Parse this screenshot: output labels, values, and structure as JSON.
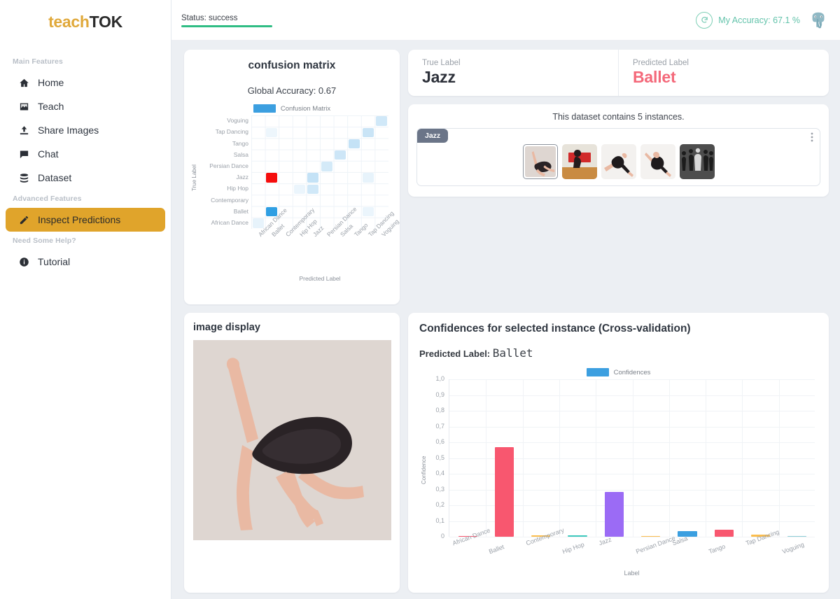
{
  "brand": {
    "part1": "teach",
    "part2": "TOK"
  },
  "sidebar": {
    "sections": [
      {
        "title": "Main Features"
      },
      {
        "title": "Advanced Features"
      },
      {
        "title": "Need Some Help?"
      }
    ],
    "items": [
      {
        "label": "Home",
        "icon": "home-icon"
      },
      {
        "label": "Teach",
        "icon": "image-icon"
      },
      {
        "label": "Share Images",
        "icon": "upload-icon"
      },
      {
        "label": "Chat",
        "icon": "chat-icon"
      },
      {
        "label": "Dataset",
        "icon": "database-icon"
      },
      {
        "label": "Inspect Predictions",
        "icon": "pencil-icon"
      },
      {
        "label": "Tutorial",
        "icon": "info-icon"
      }
    ]
  },
  "topbar": {
    "status_text": "Status: success",
    "accuracy_text": "My Accuracy: 67.1 %",
    "refresh_icon": "refresh-icon",
    "logo_icon": "elephant-icon",
    "status_color": "#2fbd84",
    "accuracy_color": "#63c3ab"
  },
  "labels": {
    "true_caption": "True Label",
    "true_value": "Jazz",
    "pred_caption": "Predicted Label",
    "pred_value": "Ballet",
    "pred_color": "#f4697a"
  },
  "instances": {
    "count_text": "This dataset contains 5 instances.",
    "group_badge": "Jazz",
    "kebab_icon": "more-vertical-icon",
    "thumbs": [
      {
        "name": "dancer-backbend",
        "selected": true
      },
      {
        "name": "dancer-red-banner",
        "selected": false
      },
      {
        "name": "dancer-leap-1",
        "selected": false
      },
      {
        "name": "dancer-leap-2",
        "selected": false
      },
      {
        "name": "dancers-group-bw",
        "selected": false
      }
    ]
  },
  "image_display": {
    "title": "image display",
    "image_name": "dancer-backbend-photo"
  },
  "confidences_panel": {
    "title": "Confidences for selected instance (Cross-validation)",
    "pred_prefix": "Predicted Label:",
    "pred_value": "Ballet"
  },
  "chart_data": [
    {
      "id": "confusion-matrix",
      "type": "heatmap",
      "title": "confusion matrix",
      "subtitle": "Global Accuracy: 0.67",
      "legend": "Confusion Matrix",
      "legend_position": "top",
      "xlabel": "Predicted Label",
      "ylabel": "True Label",
      "x_categories": [
        "African Dance",
        "Ballet",
        "Contemporary",
        "Hip Hop",
        "Jazz",
        "Persian Dance",
        "Salsa",
        "Tango",
        "Tap Dancing",
        "Voguing"
      ],
      "y_categories": [
        "African Dance",
        "Ballet",
        "Contemporary",
        "Hip Hop",
        "Jazz",
        "Persian Dance",
        "Salsa",
        "Tango",
        "Tap Dancing",
        "Voguing"
      ],
      "cells": [
        {
          "x": "African Dance",
          "y": "African Dance",
          "v": 0.12,
          "color": "#3c9fe0"
        },
        {
          "x": "Ballet",
          "y": "Ballet",
          "v": 1.0,
          "color": "#2f9fe3",
          "highlight": "selected"
        },
        {
          "x": "Ballet",
          "y": "Jazz",
          "v": 1.0,
          "color": "#f50d0d",
          "highlight": "error"
        },
        {
          "x": "Ballet",
          "y": "Tap Dancing",
          "v": 0.09,
          "color": "#3c9fe0"
        },
        {
          "x": "Hip Hop",
          "y": "Hip Hop",
          "v": 0.1,
          "color": "#3c9fe0"
        },
        {
          "x": "Jazz",
          "y": "Jazz",
          "v": 0.3,
          "color": "#3c9fe0"
        },
        {
          "x": "Jazz",
          "y": "Hip Hop",
          "v": 0.24,
          "color": "#3c9fe0"
        },
        {
          "x": "Persian Dance",
          "y": "Persian Dance",
          "v": 0.22,
          "color": "#3c9fe0"
        },
        {
          "x": "Salsa",
          "y": "Salsa",
          "v": 0.26,
          "color": "#3c9fe0"
        },
        {
          "x": "Tango",
          "y": "Tango",
          "v": 0.3,
          "color": "#3c9fe0"
        },
        {
          "x": "Tap Dancing",
          "y": "Tap Dancing",
          "v": 0.28,
          "color": "#3c9fe0"
        },
        {
          "x": "Tap Dancing",
          "y": "Jazz",
          "v": 0.12,
          "color": "#3c9fe0"
        },
        {
          "x": "Tap Dancing",
          "y": "Ballet",
          "v": 0.1,
          "color": "#3c9fe0"
        },
        {
          "x": "Voguing",
          "y": "Voguing",
          "v": 0.24,
          "color": "#3c9fe0"
        }
      ]
    },
    {
      "id": "confidences",
      "type": "bar",
      "title": "Confidences for selected instance (Cross-validation)",
      "legend": "Confidences",
      "legend_position": "top",
      "xlabel": "Label",
      "ylabel": "Confidence",
      "ylim": [
        0,
        1.0
      ],
      "yticks": [
        "0",
        "0,1",
        "0,2",
        "0,3",
        "0,4",
        "0,5",
        "0,6",
        "0,7",
        "0,8",
        "0,9",
        "1,0"
      ],
      "categories": [
        "African Dance",
        "Ballet",
        "Contemporary",
        "Hip Hop",
        "Jazz",
        "Persian Dance",
        "Salsa",
        "Tango",
        "Tap Dancing",
        "Voguing"
      ],
      "values": [
        0.001,
        0.57,
        0.01,
        0.011,
        0.286,
        0.002,
        0.037,
        0.045,
        0.014,
        0.006
      ],
      "colors": [
        "#f8576f",
        "#f8576f",
        "#fbbd4e",
        "#3fc9bd",
        "#9b6bf5",
        "#fbbd4e",
        "#3b9fe0",
        "#f8576f",
        "#fbbd4e",
        "#8ecdd6"
      ]
    }
  ]
}
